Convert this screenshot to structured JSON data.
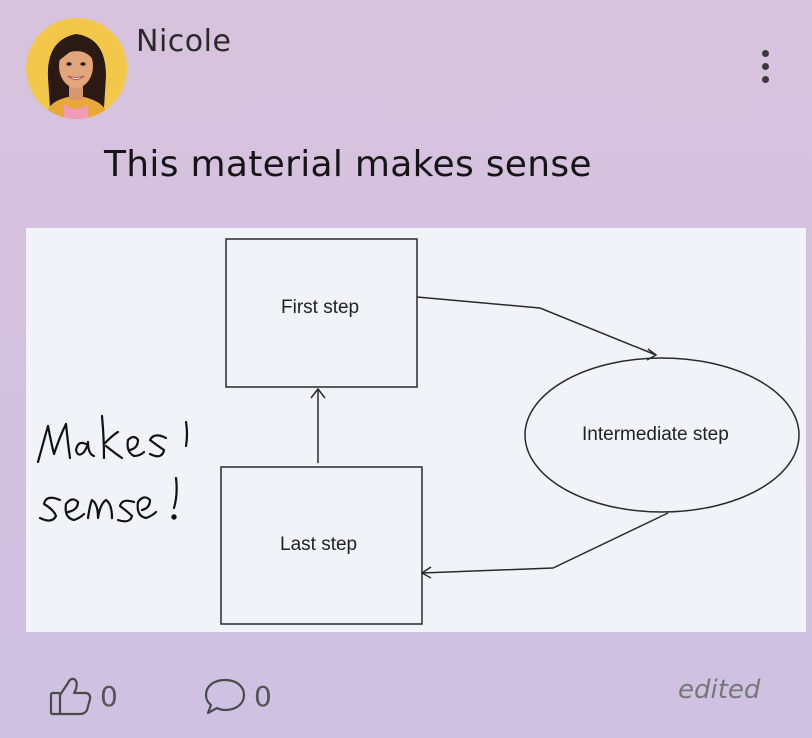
{
  "post": {
    "author": "Nicole",
    "text": "This material makes sense",
    "status": "edited"
  },
  "diagram": {
    "nodes": {
      "first": "First step",
      "intermediate": "Intermediate step",
      "last": "Last step"
    }
  },
  "actions": {
    "like_icon": "thumbs-up-icon",
    "like_count": "0",
    "comment_icon": "comment-bubble-icon",
    "comment_count": "0"
  }
}
